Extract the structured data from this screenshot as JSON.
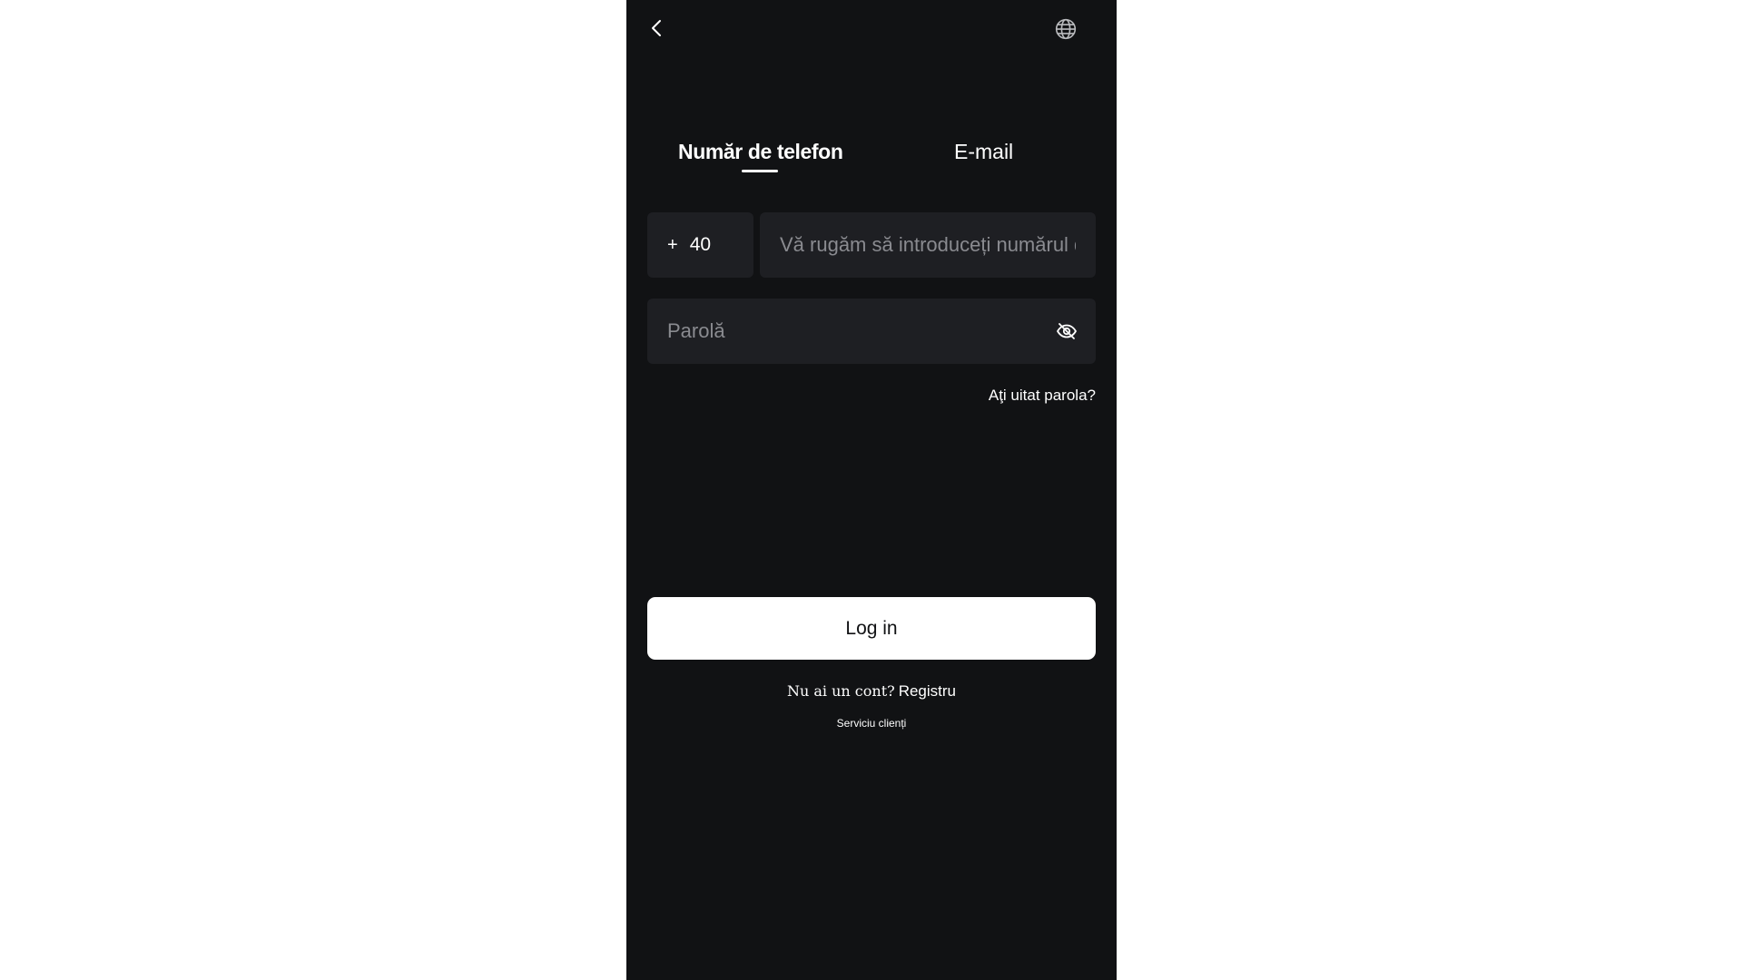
{
  "header": {
    "back_icon": "chevron-left-icon",
    "language_icon": "globe-icon"
  },
  "tabs": [
    {
      "label": "Număr de telefon",
      "active": true
    },
    {
      "label": "E-mail",
      "active": false
    }
  ],
  "form": {
    "country_code_prefix": "+",
    "country_code": "40",
    "phone_placeholder": "Vă rugăm să introduceți numărul de telefon",
    "phone_value": "",
    "password_placeholder": "Parolă",
    "password_value": "",
    "password_toggle_icon": "eye-off-icon",
    "forgot_password": "Aţi uitat parola?"
  },
  "actions": {
    "login_label": "Log in",
    "register_prompt": "Nu ai un cont?",
    "register_link": "Registru",
    "support_link": "Serviciu clienți"
  },
  "colors": {
    "background": "#111214",
    "field": "#1e1f23",
    "primary_button": "#ffffff",
    "placeholder": "#8a8b90"
  }
}
